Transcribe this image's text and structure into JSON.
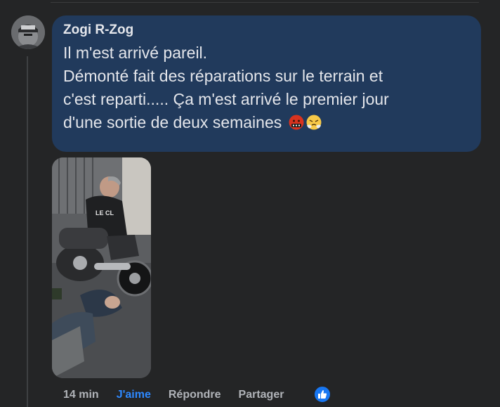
{
  "comment": {
    "author": "Zogi R-Zog",
    "lines": [
      "Il m'est arrivé pareil.",
      "Démonté fait des réparations sur le terrain et",
      "c'est reparti..... Ça m'est arrivé le premier jour",
      "d'une sortie de deux semaines"
    ],
    "emojis": [
      "face-with-symbols-on-mouth-icon",
      "face-with-steam-from-nose-icon"
    ]
  },
  "actions": {
    "time": "14 min",
    "like": "J'aime",
    "reply": "Répondre",
    "share": "Partager"
  },
  "reaction_icon": "thumbs-up-icon",
  "colors": {
    "background": "#242526",
    "bubble": "#213a5c",
    "text": "#e4e6eb",
    "muted": "#b0b3b8",
    "accent": "#2d88ff"
  }
}
